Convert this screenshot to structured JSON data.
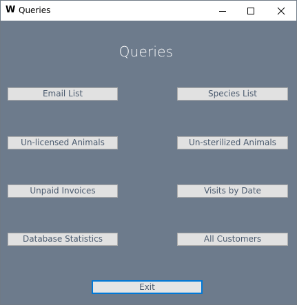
{
  "window": {
    "title": "Queries",
    "app_icon": "W",
    "controls": {
      "minimize_icon": "minimize-icon",
      "maximize_icon": "maximize-icon",
      "close_icon": "close-icon"
    }
  },
  "main": {
    "heading": "Queries",
    "buttons": {
      "email_list": "Email List",
      "species_list": "Species List",
      "unlicensed_animals": "Un-licensed Animals",
      "unsterilized_animals": "Un-sterilized Animals",
      "unpaid_invoices": "Unpaid Invoices",
      "visits_by_date": "Visits by Date",
      "database_statistics": "Database Statistics",
      "all_customers": "All Customers"
    },
    "exit_label": "Exit"
  },
  "colors": {
    "background": "#6d7b8c",
    "button_face": "#e1e1e1",
    "button_text": "#4a5a6e",
    "focus_border": "#0078d7",
    "heading_text": "#ffffff"
  }
}
